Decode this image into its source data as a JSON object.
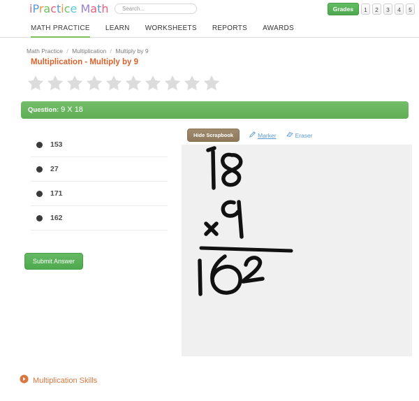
{
  "header": {
    "logo_letters": [
      {
        "ch": "i",
        "color": "#e8607f"
      },
      {
        "ch": "P",
        "color": "#5b9bd5"
      },
      {
        "ch": "r",
        "color": "#e8944a"
      },
      {
        "ch": "a",
        "color": "#6fbf5f"
      },
      {
        "ch": "c",
        "color": "#e8607f"
      },
      {
        "ch": "t",
        "color": "#5b9bd5"
      },
      {
        "ch": "i",
        "color": "#e8944a"
      },
      {
        "ch": "c",
        "color": "#6fbf5f"
      },
      {
        "ch": "e",
        "color": "#5bc8d5"
      },
      {
        "ch": " ",
        "color": "#ffffff"
      },
      {
        "ch": "M",
        "color": "#9b7fd0"
      },
      {
        "ch": "a",
        "color": "#e8607f"
      },
      {
        "ch": "t",
        "color": "#5b9bd5"
      },
      {
        "ch": "h",
        "color": "#e8607f"
      }
    ],
    "search_placeholder": "Search...",
    "search_value": "",
    "grades_label": "Grades",
    "grade_numbers": [
      "1",
      "2",
      "3",
      "4",
      "5"
    ]
  },
  "nav": {
    "items": [
      {
        "label": "MATH PRACTICE",
        "active": true
      },
      {
        "label": "LEARN",
        "active": false
      },
      {
        "label": "WORKSHEETS",
        "active": false
      },
      {
        "label": "REPORTS",
        "active": false
      },
      {
        "label": "AWARDS",
        "active": false
      }
    ]
  },
  "breadcrumb": {
    "items": [
      "Math Practice",
      "Multiplication",
      "Multiply by 9"
    ],
    "separator": "/"
  },
  "page_title": "Multiplication - Multiply by 9",
  "stars": {
    "total": 10,
    "filled": 0,
    "empty_color": "#dcdcdc"
  },
  "question": {
    "label": "Question:",
    "text": "9 X 18"
  },
  "answers": {
    "options": [
      "153",
      "27",
      "171",
      "162"
    ],
    "selected": null
  },
  "submit_label": "Submit Answer",
  "scrapbook": {
    "hide_label": "Hide Scrapbook",
    "marker_label": "Marker",
    "eraser_label": "Eraser",
    "active_tool": "Marker",
    "canvas_bg": "#f0f0f0",
    "ink_color": "#000000",
    "drawing_description": "Handwritten long multiplication: 18 times 9 equals 162"
  },
  "footer": {
    "link_label": "Multiplication Skills",
    "accent_color": "#d9773e"
  }
}
